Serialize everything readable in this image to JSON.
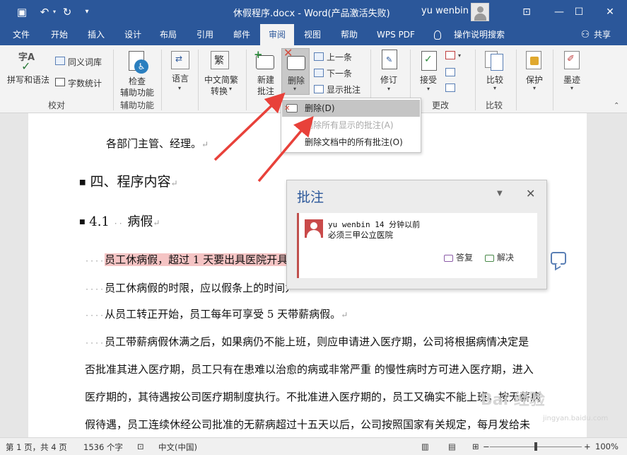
{
  "titlebar": {
    "title": "休假程序.docx  -  Word(产品激活失败)",
    "user": "yu wenbin",
    "minimize": "—",
    "restore": "☐",
    "close": "✕",
    "ribbon_display": "⊡"
  },
  "tabs": {
    "file": "文件",
    "home": "开始",
    "insert": "插入",
    "design": "设计",
    "layout": "布局",
    "references": "引用",
    "mailings": "邮件",
    "review": "审阅",
    "view": "视图",
    "help": "帮助",
    "wps": "WPS PDF",
    "tell_me": "操作说明搜索",
    "share": "共享"
  },
  "ribbon": {
    "spelling": "拼写和语法",
    "thesaurus": "同义词库",
    "word_count": "字数统计",
    "group_proofing": "校对",
    "check_access_1": "检查",
    "check_access_2": "辅助功能",
    "group_access": "辅助功能",
    "language": "语言",
    "convert_1": "中文简繁",
    "convert_2": "转换",
    "new_comment_1": "新建",
    "new_comment_2": "批注",
    "delete": "删除",
    "previous": "上一条",
    "next": "下一条",
    "show_comments": "显示批注",
    "track": "修订",
    "accept": "接受",
    "group_changes": "更改",
    "compare": "比较",
    "group_compare": "比较",
    "protect": "保护",
    "ink": "墨迹",
    "ink_icon_text": "字A",
    "trad_icon_text": "繁"
  },
  "dropdown": {
    "delete": "删除(D)",
    "delete_shown": "删除所有显示的批注(A)",
    "delete_all": "删除文档中的所有批注(O)"
  },
  "document": {
    "line1": "各部门主管、经理。",
    "heading4": "四、程序内容",
    "heading41_num": "4.1",
    "heading41_text": "病假",
    "p1": "员工休病假，超过 1 天要出具医院开具的",
    "p2": "员工休病假的时限，应以假条上的时间为准，超不能超年假规定。",
    "p3": "从员工转正开始，员工每年可享受 5 天带薪病假。",
    "p4": "员工带薪病假休满之后，如果病仍不能上班，则应申请进入医疗期，公司将根据病情决定是",
    "p5": "否批准其进入医疗期，员工只有在患难以治愈的病或非常严重 的慢性病时方可进入医疗期，进入",
    "p6": "医疗期的，其待遇按公司医疗期制度执行。不批准进入医疗期的，员工又确实不能上班，按无薪病",
    "p7": "假待遇，员工连续休经公司批准的无薪病超过十五天以后，公司按照国家有关规定，每月发给未",
    "para_mark": "↵"
  },
  "comment_pane": {
    "title": "批注",
    "author": "yu wenbin",
    "time": "14 分钟以前",
    "text": "必须三甲公立医院",
    "reply": "答复",
    "resolve": "解决"
  },
  "statusbar": {
    "page": "第 1 页，共 4 页",
    "words": "1536 个字",
    "language": "中文(中国)",
    "zoom": "100%",
    "zoom_level_percent": 100
  },
  "watermark": {
    "text": "Bai 经验",
    "url": "jingyan.baidu.com"
  },
  "colors": {
    "word_blue": "#2b579a",
    "highlight": "#f5c4c4",
    "arrow_red": "#e8413a",
    "comment_bar": "#c0504d"
  }
}
